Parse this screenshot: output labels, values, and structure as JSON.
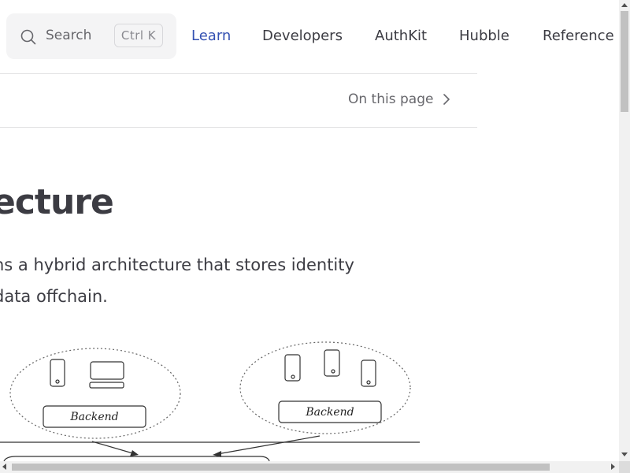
{
  "nav": {
    "search_label": "Search",
    "search_shortcut": "Ctrl K",
    "links": [
      {
        "label": "Learn",
        "active": true
      },
      {
        "label": "Developers",
        "active": false
      },
      {
        "label": "AuthKit",
        "active": false
      },
      {
        "label": "Hubble",
        "active": false
      },
      {
        "label": "Reference",
        "active": false
      }
    ]
  },
  "local_nav": {
    "on_this_page": "On this page"
  },
  "content": {
    "heading": "ecture",
    "para_line1": "ns a hybrid architecture that stores identity",
    "para_line2": " data offchain."
  },
  "diagram": {
    "left_backend_label": "Backend",
    "right_backend_label": "Backend"
  },
  "colors": {
    "accent": "#3451b2",
    "text": "#3c3c43",
    "muted": "#67676c"
  }
}
